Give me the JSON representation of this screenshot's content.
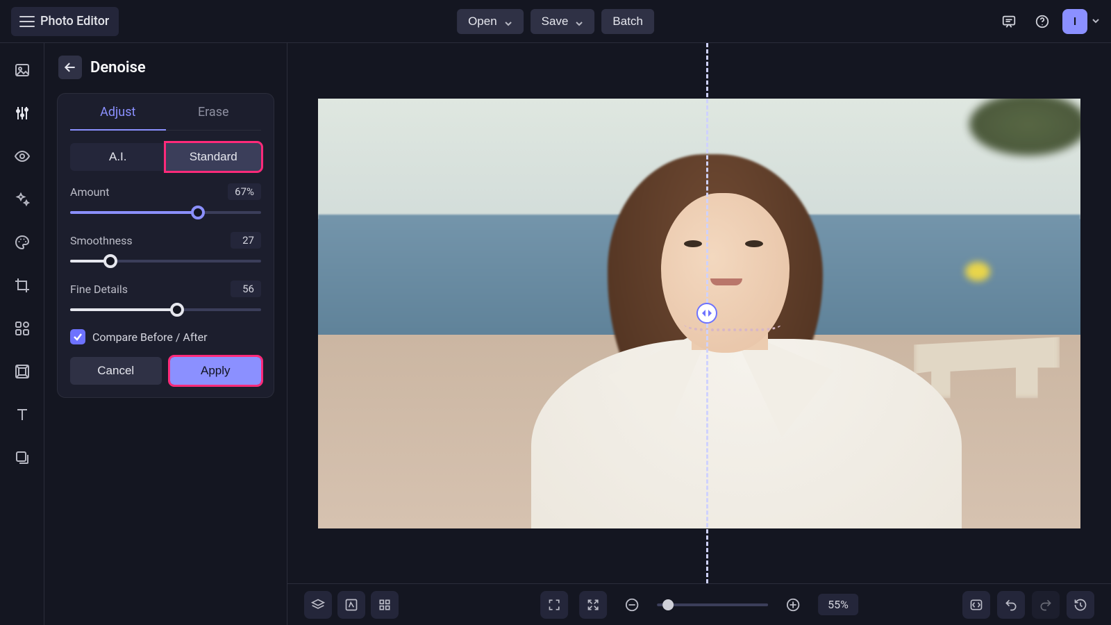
{
  "app": {
    "title": "Photo Editor"
  },
  "header": {
    "open": "Open",
    "save": "Save",
    "batch": "Batch"
  },
  "user": {
    "initial": "I"
  },
  "panel": {
    "title": "Denoise",
    "tabs": {
      "adjust": "Adjust",
      "erase": "Erase",
      "active": "adjust"
    },
    "mode": {
      "ai": "A.I.",
      "standard": "Standard",
      "selected": "standard"
    },
    "sliders": {
      "amount": {
        "label": "Amount",
        "value": 67,
        "display": "67%"
      },
      "smoothness": {
        "label": "Smoothness",
        "value": 27,
        "display": "27"
      },
      "details": {
        "label": "Fine Details",
        "value": 56,
        "display": "56"
      }
    },
    "compare": {
      "label": "Compare Before / After",
      "checked": true
    },
    "actions": {
      "cancel": "Cancel",
      "apply": "Apply"
    }
  },
  "canvas": {
    "split_percent": 46
  },
  "bottombar": {
    "zoom": {
      "display": "55%",
      "value": 10
    }
  },
  "highlights": {
    "standard_button": true,
    "apply_button": true,
    "color": "#ff2a7a"
  }
}
